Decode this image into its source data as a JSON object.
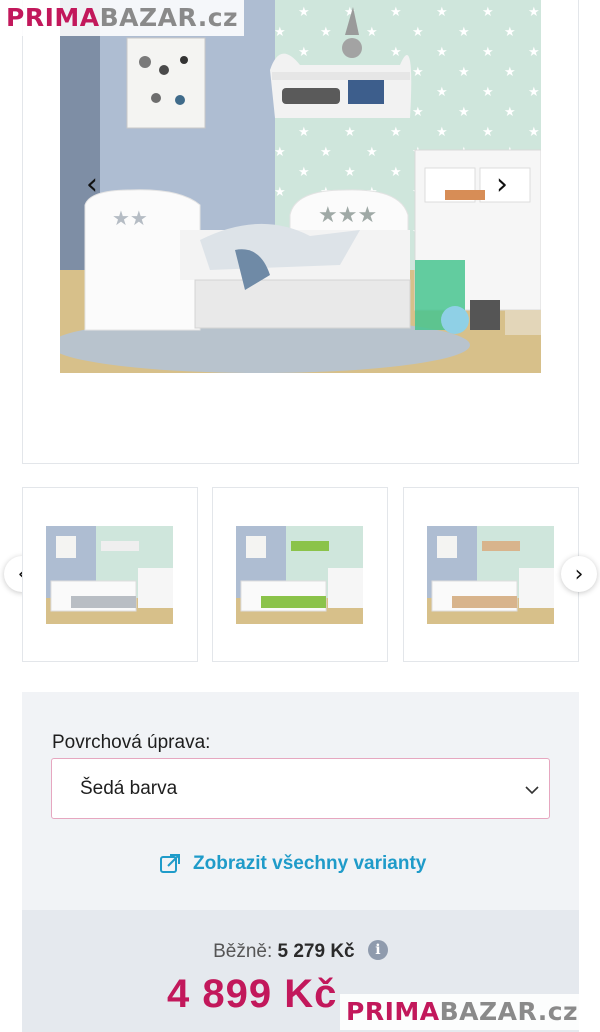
{
  "watermark": {
    "part1": "PRIMA",
    "part2": "BAZAR.cz"
  },
  "gallery": {
    "prev_arrow": "‹",
    "next_arrow": "›",
    "thumbs": [
      {
        "variant": "gray",
        "accent": "#b9bec4"
      },
      {
        "variant": "green",
        "accent": "#8bc34a"
      },
      {
        "variant": "wood",
        "accent": "#d8b48c"
      }
    ],
    "thumb_prev": "‹",
    "thumb_next": "›"
  },
  "variant": {
    "label": "Povrchová úprava:",
    "selected": "Šedá barva",
    "link_text": "Zobrazit všechny varianty",
    "link_icon": "external-link-icon"
  },
  "price": {
    "regular_label": "Běžně:",
    "regular_value": "5 279 Kč",
    "current": "4 899 Kč",
    "info_icon": "info-icon"
  },
  "colors": {
    "accent": "#c2185b",
    "link": "#1f9bc9",
    "panel": "#f1f3f6"
  }
}
